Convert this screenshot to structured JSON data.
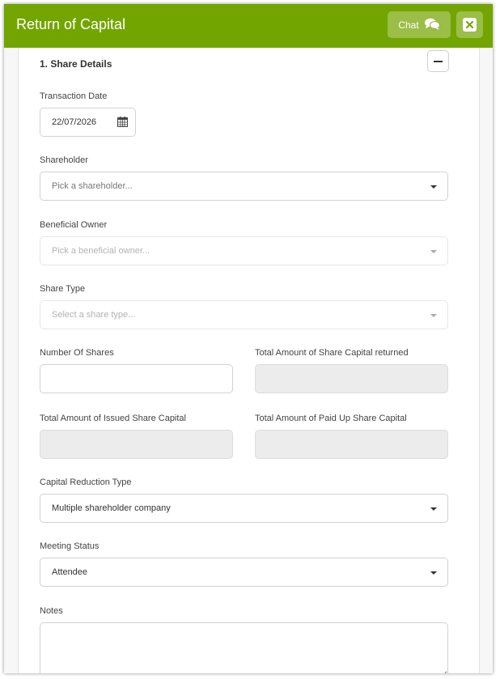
{
  "window": {
    "title": "Return of Capital"
  },
  "header": {
    "chat_label": "Chat",
    "chat_icon": "chat-bubbles-icon",
    "close_icon": "close-icon"
  },
  "section": {
    "title": "1. Share Details",
    "collapse_icon": "minus-icon"
  },
  "fields": {
    "transaction_date": {
      "label": "Transaction Date",
      "value": "22/07/2026",
      "icon": "calendar-icon"
    },
    "shareholder": {
      "label": "Shareholder",
      "placeholder": "Pick a shareholder..."
    },
    "beneficial_owner": {
      "label": "Beneficial Owner",
      "placeholder": "Pick a beneficial owner..."
    },
    "share_type": {
      "label": "Share Type",
      "placeholder": "Select a share type..."
    },
    "number_of_shares": {
      "label": "Number Of Shares",
      "value": ""
    },
    "total_returned": {
      "label": "Total Amount of Share Capital returned",
      "value": ""
    },
    "total_issued": {
      "label": "Total Amount of Issued Share Capital",
      "value": ""
    },
    "total_paid_up": {
      "label": "Total Amount of Paid Up Share Capital",
      "value": ""
    },
    "capital_reduction_type": {
      "label": "Capital Reduction Type",
      "value": "Multiple shareholder company"
    },
    "meeting_status": {
      "label": "Meeting Status",
      "value": "Attendee"
    },
    "notes": {
      "label": "Notes",
      "value": ""
    }
  },
  "colors": {
    "header_bg": "#73a500"
  }
}
